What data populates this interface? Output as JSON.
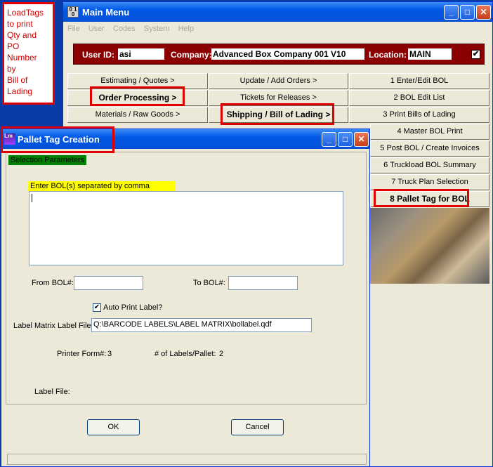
{
  "annotation": {
    "lines": [
      "LoadTags",
      "to print",
      "Qty and",
      "PO Number",
      "by",
      "Bill of",
      "Lading"
    ]
  },
  "main_menu": {
    "title": "Main Menu",
    "title_icon": "app-icon",
    "menus": [
      "File",
      "User",
      "Codes",
      "System",
      "Help"
    ],
    "user_bar": {
      "user_id_label": "User ID:",
      "user_id": "asi",
      "company_label": "Company:",
      "company": "Advanced Box Company 001 V10",
      "location_label": "Location:",
      "location": "MAIN",
      "checkbox": "✔"
    },
    "col1": [
      "Estimating / Quotes >",
      "Order Processing >",
      "Materials / Raw Goods >"
    ],
    "col2": [
      "Update / Add Orders >",
      "Tickets for Releases >",
      "Shipping / Bill of Lading >"
    ],
    "col3": [
      "1 Enter/Edit BOL",
      "2 BOL Edit List",
      "3 Print Bills of Lading",
      "4 Master BOL Print",
      "5 Post BOL / Create Invoices",
      "6 Truckload BOL Summary",
      "7 Truck Plan Selection",
      "8 Pallet Tag for BOL"
    ]
  },
  "pallet_dialog": {
    "title": "Pallet Tag Creation",
    "selection_params": "Selection Parameters",
    "bol_prompt": "Enter BOL(s) separated by comma",
    "bol_text": "",
    "from_bol_label": "From BOL#:",
    "from_bol": "",
    "to_bol_label": "To BOL#:",
    "to_bol": "",
    "auto_print_label": "Auto Print Label?",
    "auto_print_mark": "✔",
    "label_matrix_label": "Label Matrix Label File:",
    "label_matrix_file": "Q:\\BARCODE LABELS\\LABEL MATRIX\\bollabel.qdf",
    "printer_form_label": "Printer Form#:",
    "printer_form": "3",
    "labels_per_pallet_label": "# of Labels/Pallet:",
    "labels_per_pallet": "2",
    "label_file_label": "Label File:",
    "ok": "OK",
    "cancel": "Cancel"
  }
}
